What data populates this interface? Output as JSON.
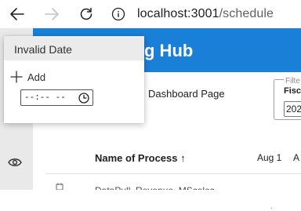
{
  "browser": {
    "url_host": "localhost:3001",
    "url_path": "/schedule",
    "icons": [
      "back-arrow-icon",
      "forward-arrow-icon",
      "refresh-icon",
      "info-icon"
    ]
  },
  "app": {
    "title_fragment": "g Hub",
    "page_label_fragment": "Dashboard Page"
  },
  "filter": {
    "legend_fragment": "Filte",
    "label_fragment": "Fisc",
    "value_fragment": "202"
  },
  "table": {
    "columns": [
      {
        "label": "Name of Process ↑"
      },
      {
        "label": "Aug 1"
      },
      {
        "label": "A"
      }
    ],
    "first_row_text": "DataPull_Revenue_MScales"
  },
  "sidebar": {
    "icons": [
      "settings-icon",
      "eye-icon"
    ]
  },
  "popup": {
    "header": "Invalid Date",
    "add_label": "Add",
    "time_value": "--:-- --"
  },
  "colors": {
    "header_blue": "#1a7fd6",
    "sidebar_gray": "#e9e9e9",
    "popup_header_gray": "#ebebeb"
  }
}
